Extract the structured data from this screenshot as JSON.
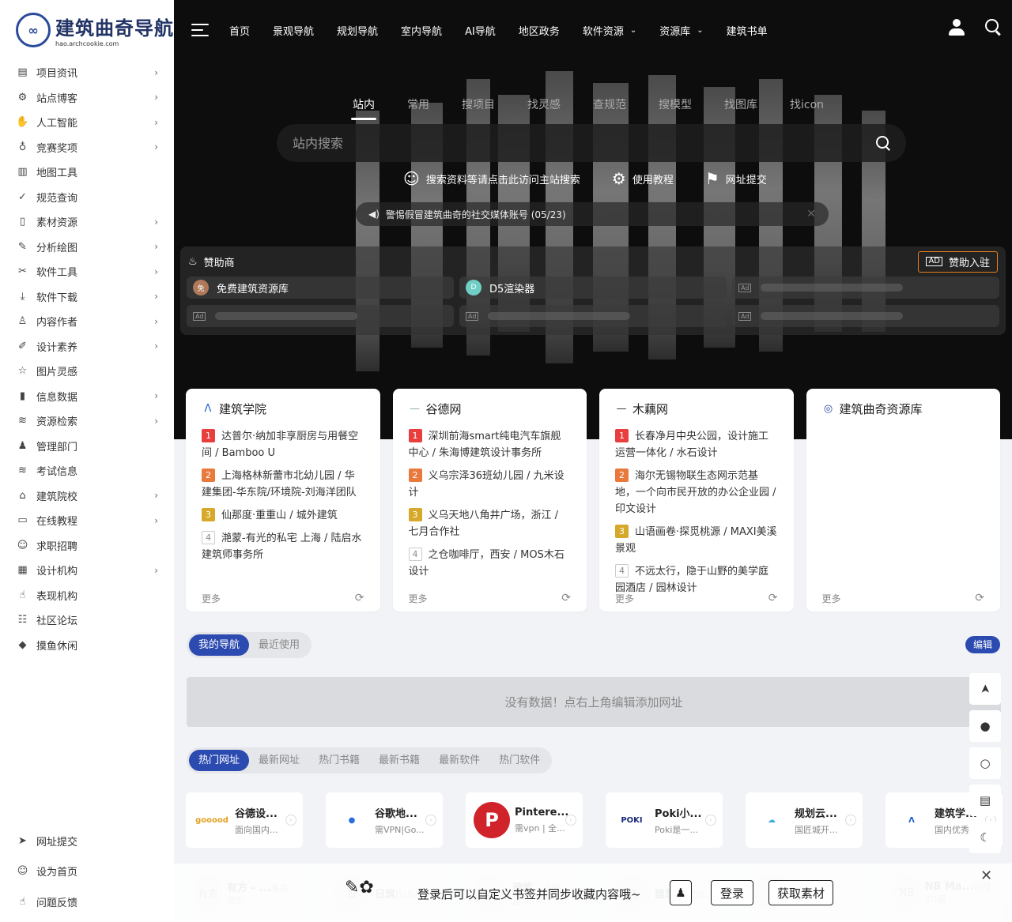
{
  "logo": {
    "title": "建筑曲奇导航",
    "subtitle": "hao.archcookie.com"
  },
  "sidebar": {
    "items": [
      {
        "label": "项目资讯",
        "icon": "newspaper-icon",
        "glyph": "▤",
        "chevron": true
      },
      {
        "label": "站点博客",
        "icon": "gear-icon",
        "glyph": "⚙",
        "chevron": true
      },
      {
        "label": "人工智能",
        "icon": "robot-hand-icon",
        "glyph": "✋",
        "chevron": true
      },
      {
        "label": "竞赛奖项",
        "icon": "award-icon",
        "glyph": "♁",
        "chevron": true
      },
      {
        "label": "地图工具",
        "icon": "map-icon",
        "glyph": "▥",
        "chevron": false
      },
      {
        "label": "规范查询",
        "icon": "check-circle-icon",
        "glyph": "✓",
        "chevron": false
      },
      {
        "label": "素材资源",
        "icon": "file-icon",
        "glyph": "▯",
        "chevron": true
      },
      {
        "label": "分析绘图",
        "icon": "pencil-icon",
        "glyph": "✎",
        "chevron": true
      },
      {
        "label": "软件工具",
        "icon": "tools-icon",
        "glyph": "✂",
        "chevron": true
      },
      {
        "label": "软件下载",
        "icon": "download-icon",
        "glyph": "⤓",
        "chevron": true
      },
      {
        "label": "内容作者",
        "icon": "user-icon",
        "glyph": "♙",
        "chevron": true
      },
      {
        "label": "设计素养",
        "icon": "brush-icon",
        "glyph": "✐",
        "chevron": true
      },
      {
        "label": "图片灵感",
        "icon": "star-icon",
        "glyph": "☆",
        "chevron": false
      },
      {
        "label": "信息数据",
        "icon": "bar-chart-icon",
        "glyph": "▮",
        "chevron": true
      },
      {
        "label": "资源检索",
        "icon": "layers-icon",
        "glyph": "≋",
        "chevron": true
      },
      {
        "label": "管理部门",
        "icon": "admin-user-icon",
        "glyph": "♟",
        "chevron": false
      },
      {
        "label": "考试信息",
        "icon": "stack-icon",
        "glyph": "≋",
        "chevron": false
      },
      {
        "label": "建筑院校",
        "icon": "university-icon",
        "glyph": "⌂",
        "chevron": true
      },
      {
        "label": "在线教程",
        "icon": "monitor-icon",
        "glyph": "▭",
        "chevron": true
      },
      {
        "label": "求职招聘",
        "icon": "user-circle-icon",
        "glyph": "☺",
        "chevron": false
      },
      {
        "label": "设计机构",
        "icon": "building-icon",
        "glyph": "▦",
        "chevron": true
      },
      {
        "label": "表现机构",
        "icon": "thumbs-up-icon",
        "glyph": "☝",
        "chevron": false
      },
      {
        "label": "社区论坛",
        "icon": "chat-icon",
        "glyph": "☷",
        "chevron": false
      },
      {
        "label": "摸鱼休闲",
        "icon": "fish-icon",
        "glyph": "◆",
        "chevron": false
      }
    ],
    "bottom": [
      {
        "label": "网址提交",
        "icon": "send-icon",
        "glyph": "➤"
      },
      {
        "label": "设为首页",
        "icon": "smile-icon",
        "glyph": "☺"
      },
      {
        "label": "问题反馈",
        "icon": "hand-icon",
        "glyph": "☝"
      }
    ]
  },
  "topnav": {
    "items": [
      {
        "label": "首页",
        "dropdown": false
      },
      {
        "label": "景观导航",
        "dropdown": false
      },
      {
        "label": "规划导航",
        "dropdown": false
      },
      {
        "label": "室内导航",
        "dropdown": false
      },
      {
        "label": "AI导航",
        "dropdown": false
      },
      {
        "label": "地区政务",
        "dropdown": false
      },
      {
        "label": "软件资源",
        "dropdown": true
      },
      {
        "label": "资源库",
        "dropdown": true
      },
      {
        "label": "建筑书单",
        "dropdown": false
      }
    ]
  },
  "search": {
    "tabs": [
      "站内",
      "常用",
      "搜项目",
      "找灵感",
      "查规范",
      "搜模型",
      "找图库",
      "找icon"
    ],
    "active_tab": 0,
    "placeholder": "站内搜索",
    "links": [
      {
        "label": "搜索资料等请点击此访问主站搜索",
        "icon": "smile-icon",
        "glyph": "☺"
      },
      {
        "label": "使用教程",
        "icon": "gear-icon",
        "glyph": "⚙"
      },
      {
        "label": "网址提交",
        "icon": "bookmark-icon",
        "glyph": "⚑"
      }
    ],
    "notice": "警惕假冒建筑曲奇的社交媒体账号 (05/23)"
  },
  "sponsor": {
    "title": "赞助商",
    "join_label": "赞助入驻",
    "ad_label": "Ad",
    "items": [
      {
        "label": "免费建筑资源库",
        "avatar": "免",
        "color": "#b07a5a"
      },
      {
        "label": "D5渲染器",
        "avatar": "D",
        "color": "#6fcfc7"
      }
    ]
  },
  "hot_cards": [
    {
      "source": "建筑学院",
      "logo_glyph": "Λ",
      "logo_color": "#1a5fd0",
      "items": [
        "达普尔·纳加非享厨房与用餐空间 / Bamboo U",
        "上海格林新蕾市北幼儿园 / 华建集团-华东院/环境院-刘海洋团队",
        "仙那度·重重山 / 城外建筑",
        "滟蒙-有光的私宅 上海 / 陆启水建筑师事务所"
      ]
    },
    {
      "source": "谷德网",
      "logo_glyph": "—",
      "logo_color": "#8aa",
      "items": [
        "深圳前海smart纯电汽车旗舰中心 / 朱海博建筑设计事务所",
        "义乌宗泽36班幼儿园 / 九米设计",
        "义乌天地八角井广场，浙江 / 七月合作社",
        "之仓咖啡厅，西安 / MOS木石设计"
      ]
    },
    {
      "source": "木藕网",
      "logo_glyph": "—",
      "logo_color": "#333",
      "items": [
        "长春净月中央公园，设计施工运营一体化 / 水石设计",
        "海尔无锡物联生态网示范基地，一个向市民开放的办公企业园 / 印文设计",
        "山语画卷·探觅桃源 / MAXI美溪景观",
        "不远太行，隐于山野的美学庭园酒店 / 园林设计"
      ]
    },
    {
      "source": "建筑曲奇资源库",
      "logo_glyph": "◎",
      "logo_color": "#2b4a9b",
      "items": []
    }
  ],
  "card_more_label": "更多",
  "my_nav": {
    "tabs": [
      "我的导航",
      "最近使用"
    ],
    "active": 0,
    "edit_label": "编辑",
    "empty_text": "没有数据！点右上角编辑添加网址"
  },
  "hot_sites": {
    "tabs": [
      "热门网址",
      "最新网址",
      "热门书籍",
      "最新书籍",
      "最新软件",
      "热门软件"
    ],
    "active": 0,
    "items": [
      {
        "name": "谷德设...",
        "desc": "面向国内...",
        "logo": "gooood",
        "logo_color": "#e0a020",
        "logo_bg": "#fff"
      },
      {
        "name": "谷歌地...",
        "desc": "需VPN|Go...",
        "logo": "●",
        "logo_color": "#2a6ee0",
        "logo_bg": "#fff"
      },
      {
        "name": "Pintere...",
        "desc": "需vpn | 全...",
        "logo": "P",
        "logo_color": "#fff",
        "logo_bg": "#d0232a"
      },
      {
        "name": "Poki小...",
        "desc": "Poki是一...",
        "logo": "POKI",
        "logo_color": "#1a2a7a",
        "logo_bg": "#fff"
      },
      {
        "name": "规划云...",
        "desc": "国匠城开...",
        "logo": "☁",
        "logo_color": "#3aaee0",
        "logo_bg": "#fff"
      },
      {
        "name": "建筑学...",
        "desc": "国内优秀...",
        "logo": "Λ",
        "logo_color": "#1a5fd0",
        "logo_bg": "#fff"
      }
    ],
    "row2": [
      {
        "name": "有方 - ...",
        "desc": "高品质的...",
        "logo": "有方"
      },
      {
        "name": "日筑",
        "desc": "Daily...",
        "logo": "日"
      },
      {
        "name": "建筑...",
        "desc": "网络建...",
        "logo": "建"
      },
      {
        "name": "建筑...",
        "desc": "建筑...",
        "logo": "筑"
      },
      {
        "name": "找素材",
        "desc": "...",
        "logo": "素"
      },
      {
        "name": "NB Ma...",
        "desc": "在线3D图...",
        "logo": "NB"
      }
    ]
  },
  "login_bar": {
    "text": "登录后可以自定义书签并同步收藏内容哦~",
    "login_label": "登录",
    "get_label": "获取素材"
  },
  "float_bar": [
    {
      "icon": "arrow-up-icon",
      "glyph": "➤"
    },
    {
      "icon": "cookie-icon",
      "glyph": "●"
    },
    {
      "icon": "search-icon",
      "glyph": "○"
    },
    {
      "icon": "calendar-icon",
      "glyph": "▤"
    },
    {
      "icon": "moon-icon",
      "glyph": "☾"
    }
  ]
}
